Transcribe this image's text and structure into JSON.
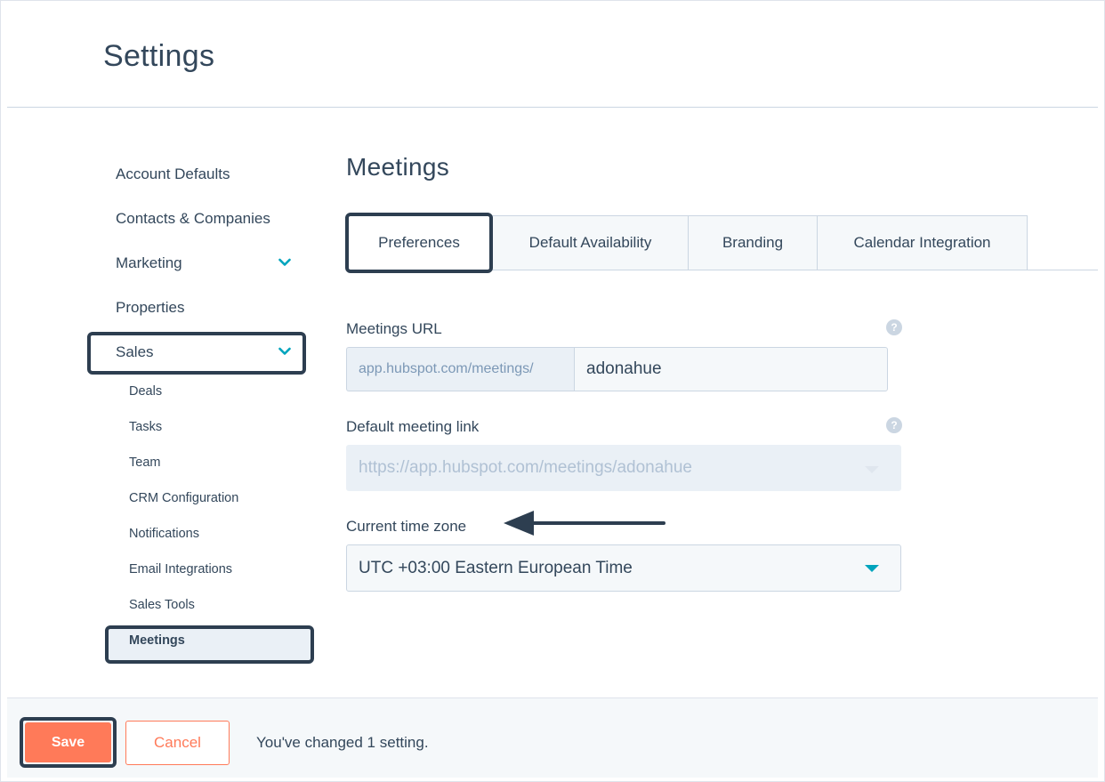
{
  "header": {
    "title": "Settings"
  },
  "sidebar": {
    "items": [
      {
        "label": "Account Defaults"
      },
      {
        "label": "Contacts & Companies"
      },
      {
        "label": "Marketing"
      },
      {
        "label": "Properties"
      },
      {
        "label": "Sales"
      }
    ],
    "sales_subitems": [
      {
        "label": "Deals"
      },
      {
        "label": "Tasks"
      },
      {
        "label": "Team"
      },
      {
        "label": "CRM Configuration"
      },
      {
        "label": "Notifications"
      },
      {
        "label": "Email Integrations"
      },
      {
        "label": "Sales Tools"
      },
      {
        "label": "Meetings"
      }
    ],
    "active_item": "Meetings"
  },
  "main": {
    "title": "Meetings",
    "tabs": [
      {
        "label": "Preferences",
        "active": true
      },
      {
        "label": "Default Availability"
      },
      {
        "label": "Branding"
      },
      {
        "label": "Calendar Integration"
      }
    ],
    "meetings_url": {
      "label": "Meetings URL",
      "prefix": "app.hubspot.com/meetings/",
      "value": "adonahue",
      "help_icon": "question-circle-icon"
    },
    "default_meeting_link": {
      "label": "Default meeting link",
      "value": "https://app.hubspot.com/meetings/adonahue",
      "disabled": true,
      "help_icon": "question-circle-icon"
    },
    "time_zone": {
      "label": "Current time zone",
      "value": "UTC +03:00 Eastern European Time"
    },
    "help_glyph": "?"
  },
  "footer": {
    "save_label": "Save",
    "cancel_label": "Cancel",
    "status": "You've changed 1 setting."
  },
  "colors": {
    "text": "#33475b",
    "accent_orange": "#ff7a59",
    "accent_teal": "#00a4bd",
    "highlight_outline": "#2d3e50",
    "field_bg": "#f5f8fa",
    "disabled_bg": "#eaf0f6",
    "border": "#cbd6e2"
  }
}
